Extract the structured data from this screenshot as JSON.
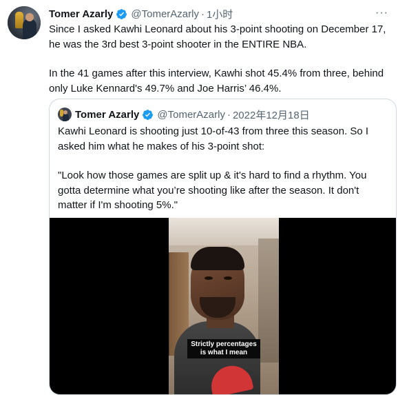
{
  "tweet": {
    "author_name": "Tomer Azarly",
    "handle": "@TomerAzarly",
    "separator": "·",
    "time": "1小时",
    "more": "···",
    "text_1": "Since I asked Kawhi Leonard about his 3-point shooting on December 17, he was the 3rd best 3-point shooter in the ENTIRE NBA.",
    "text_2": "In the 41 games after this interview, Kawhi shot 45.4% from three, behind only Luke Kennard's 49.7% and Joe Harris’ 46.4%."
  },
  "quote": {
    "author_name": "Tomer Azarly",
    "handle": "@TomerAzarly",
    "separator": "·",
    "date": "2022年12月18日",
    "text_1": "Kawhi Leonard is shooting just 10-of-43 from three this season. So I asked him what he makes of his 3-point shot:",
    "text_2": "\"Look how those games are split up & it's hard to find a rhythm. You gotta determine what you’re shooting like after the season. It don't matter if I'm shooting 5%.\"",
    "video_caption_1": "Strictly percentages",
    "video_caption_2": "is what I mean"
  },
  "colors": {
    "verified": "#1d9bf0",
    "secondary_text": "#536471",
    "border": "#cfd9de"
  },
  "icons": {
    "verified": "verified-badge-icon",
    "more": "more-horizontal-icon"
  }
}
